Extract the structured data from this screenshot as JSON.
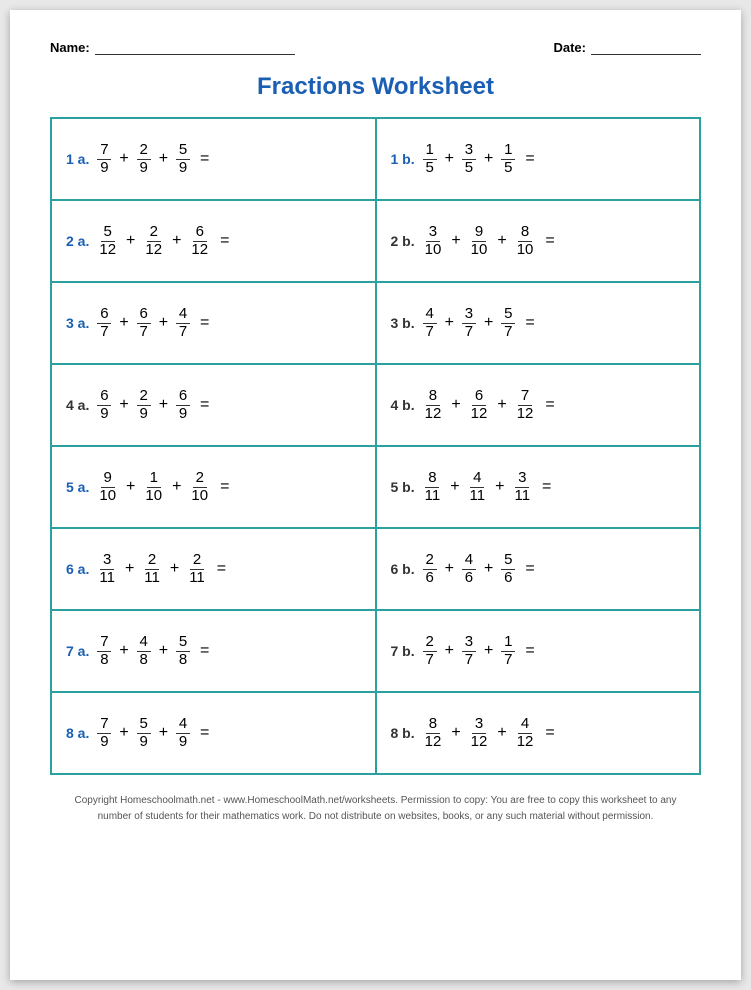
{
  "header": {
    "name_label": "Name:",
    "date_label": "Date:"
  },
  "title": "Fractions Worksheet",
  "rows": [
    {
      "a": {
        "label": "1 a.",
        "colored": true,
        "fractions": [
          {
            "n": "7",
            "d": "9"
          },
          {
            "n": "2",
            "d": "9"
          },
          {
            "n": "5",
            "d": "9"
          }
        ]
      },
      "b": {
        "label": "1 b.",
        "colored": true,
        "fractions": [
          {
            "n": "1",
            "d": "5"
          },
          {
            "n": "3",
            "d": "5"
          },
          {
            "n": "1",
            "d": "5"
          }
        ]
      }
    },
    {
      "a": {
        "label": "2 a.",
        "colored": true,
        "fractions": [
          {
            "n": "5",
            "d": "12"
          },
          {
            "n": "2",
            "d": "12"
          },
          {
            "n": "6",
            "d": "12"
          }
        ]
      },
      "b": {
        "label": "2 b.",
        "colored": false,
        "fractions": [
          {
            "n": "3",
            "d": "10"
          },
          {
            "n": "9",
            "d": "10"
          },
          {
            "n": "8",
            "d": "10"
          }
        ]
      }
    },
    {
      "a": {
        "label": "3 a.",
        "colored": true,
        "fractions": [
          {
            "n": "6",
            "d": "7"
          },
          {
            "n": "6",
            "d": "7"
          },
          {
            "n": "4",
            "d": "7"
          }
        ]
      },
      "b": {
        "label": "3 b.",
        "colored": false,
        "fractions": [
          {
            "n": "4",
            "d": "7"
          },
          {
            "n": "3",
            "d": "7"
          },
          {
            "n": "5",
            "d": "7"
          }
        ]
      }
    },
    {
      "a": {
        "label": "4 a.",
        "colored": false,
        "fractions": [
          {
            "n": "6",
            "d": "9"
          },
          {
            "n": "2",
            "d": "9"
          },
          {
            "n": "6",
            "d": "9"
          }
        ]
      },
      "b": {
        "label": "4 b.",
        "colored": false,
        "fractions": [
          {
            "n": "8",
            "d": "12"
          },
          {
            "n": "6",
            "d": "12"
          },
          {
            "n": "7",
            "d": "12"
          }
        ]
      }
    },
    {
      "a": {
        "label": "5 a.",
        "colored": true,
        "fractions": [
          {
            "n": "9",
            "d": "10"
          },
          {
            "n": "1",
            "d": "10"
          },
          {
            "n": "2",
            "d": "10"
          }
        ]
      },
      "b": {
        "label": "5 b.",
        "colored": false,
        "fractions": [
          {
            "n": "8",
            "d": "11"
          },
          {
            "n": "4",
            "d": "11"
          },
          {
            "n": "3",
            "d": "11"
          }
        ]
      }
    },
    {
      "a": {
        "label": "6 a.",
        "colored": true,
        "fractions": [
          {
            "n": "3",
            "d": "11"
          },
          {
            "n": "2",
            "d": "11"
          },
          {
            "n": "2",
            "d": "11"
          }
        ]
      },
      "b": {
        "label": "6 b.",
        "colored": false,
        "fractions": [
          {
            "n": "2",
            "d": "6"
          },
          {
            "n": "4",
            "d": "6"
          },
          {
            "n": "5",
            "d": "6"
          }
        ]
      }
    },
    {
      "a": {
        "label": "7 a.",
        "colored": true,
        "fractions": [
          {
            "n": "7",
            "d": "8"
          },
          {
            "n": "4",
            "d": "8"
          },
          {
            "n": "5",
            "d": "8"
          }
        ]
      },
      "b": {
        "label": "7 b.",
        "colored": false,
        "fractions": [
          {
            "n": "2",
            "d": "7"
          },
          {
            "n": "3",
            "d": "7"
          },
          {
            "n": "1",
            "d": "7"
          }
        ]
      }
    },
    {
      "a": {
        "label": "8 a.",
        "colored": true,
        "fractions": [
          {
            "n": "7",
            "d": "9"
          },
          {
            "n": "5",
            "d": "9"
          },
          {
            "n": "4",
            "d": "9"
          }
        ]
      },
      "b": {
        "label": "8 b.",
        "colored": false,
        "fractions": [
          {
            "n": "8",
            "d": "12"
          },
          {
            "n": "3",
            "d": "12"
          },
          {
            "n": "4",
            "d": "12"
          }
        ]
      }
    }
  ],
  "footer": {
    "line1": "Copyright Homeschoolmath.net - www.HomeschoolMath.net/worksheets. Permission to copy: You are free to copy this worksheet to any",
    "line2": "number of students for their mathematics work. Do not distribute on websites, books, or any such material without permission."
  }
}
